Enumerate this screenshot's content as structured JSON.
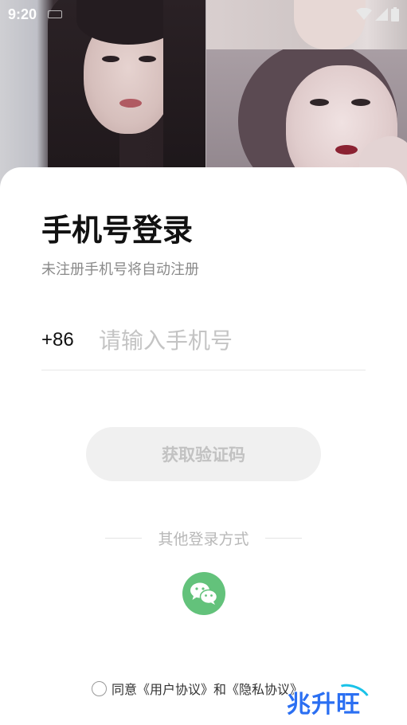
{
  "status_bar": {
    "time": "9:20",
    "keyboard_icon": "keyboard-icon",
    "wifi_icon": "wifi-icon",
    "signal_icon": "signal-icon",
    "battery_icon": "battery-icon"
  },
  "login": {
    "title": "手机号登录",
    "subtitle": "未注册手机号将自动注册",
    "country_code": "+86",
    "phone_placeholder": "请输入手机号",
    "get_code_label": "获取验证码",
    "other_login_label": "其他登录方式",
    "wechat_icon": "wechat-icon",
    "agreement_text": "同意《用户协议》和《隐私协议》"
  },
  "watermark": {
    "text": "兆升旺"
  },
  "colors": {
    "wechat_green": "#63c27b",
    "button_disabled_bg": "#f0f0f0",
    "button_disabled_text": "#c2c2c2",
    "watermark_blue": "#2b6ff2"
  }
}
